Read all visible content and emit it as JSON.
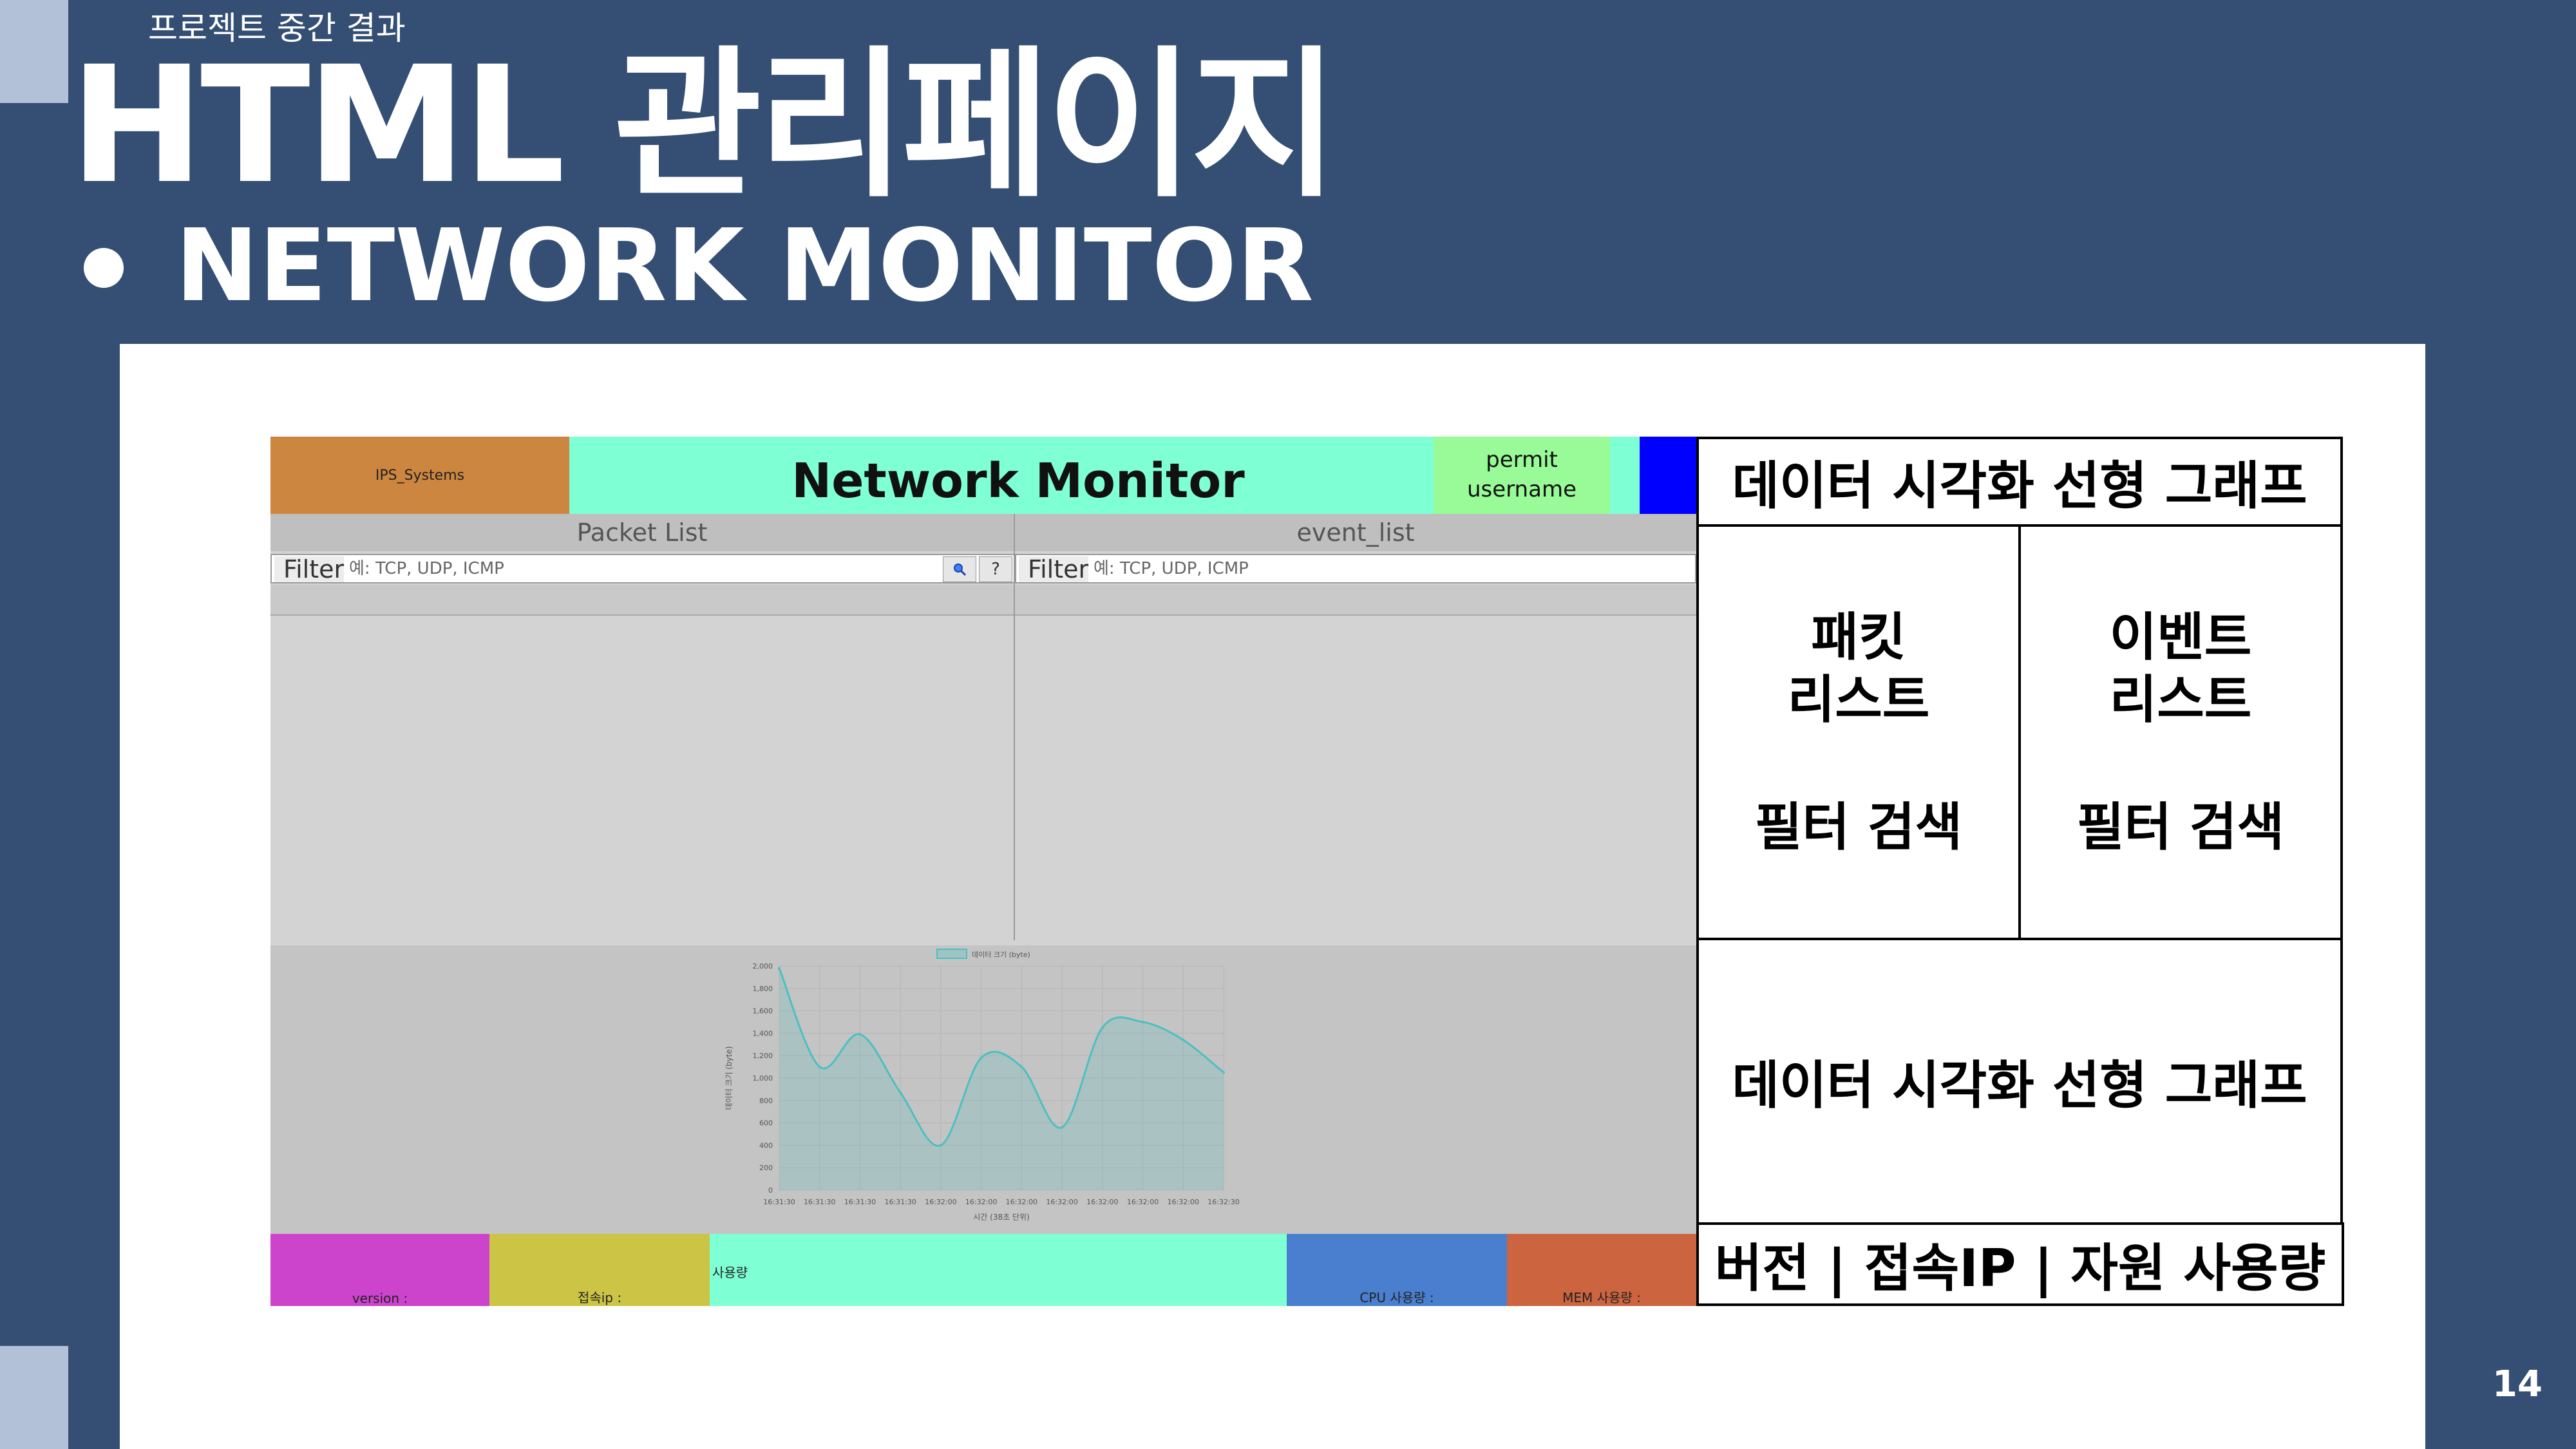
{
  "slide": {
    "kicker": "프로젝트 중간 결과",
    "title": "HTML 관리페이지",
    "section": "NETWORK MONITOR",
    "page_number": "14"
  },
  "mockup": {
    "brand": "IPS_Systems",
    "app_title": "Network Monitor",
    "permit": "permit",
    "username": "username",
    "packet_list": {
      "title": "Packet List",
      "filter_label": "Filter",
      "filter_placeholder": "예: TCP, UDP, ICMP",
      "search_icon": "search-icon",
      "help_label": "?"
    },
    "event_list": {
      "title": "event_list",
      "filter_label": "Filter",
      "filter_placeholder": "예: TCP, UDP, ICMP"
    },
    "footer": {
      "version": "version :",
      "ip": "접속ip :",
      "usage": "사용량",
      "cpu": "CPU 사용량 :",
      "mem": "MEM 사용량 :"
    },
    "colors": {
      "brand_bg": "#cc863f",
      "title_bg": "#7fffd4",
      "permit_bg": "#98fb98",
      "blue": "#0000ff",
      "version_bg": "#cc44cc",
      "ip_bg": "#ccc444",
      "usage_bg": "#7fffd4",
      "cpu_bg": "#4a7fd0",
      "mem_bg": "#cc6440",
      "line": "#4cc0c0"
    }
  },
  "chart_data": {
    "type": "area",
    "legend": "데이터 크기 (byte)",
    "ylabel": "데이터 크기 (byte)",
    "xlabel": "시간 (38초 단위)",
    "ylim": [
      0,
      2000
    ],
    "yticks": [
      "0",
      "200",
      "400",
      "600",
      "800",
      "1,000",
      "1,200",
      "1,400",
      "1,600",
      "1,800",
      "2,000"
    ],
    "x": [
      "16:31:30",
      "16:31:30",
      "16:31:30",
      "16:31:30",
      "16:32:00",
      "16:32:00",
      "16:32:00",
      "16:32:00",
      "16:32:00",
      "16:32:00",
      "16:32:00",
      "16:32:30"
    ],
    "values": [
      1980,
      1100,
      1390,
      870,
      400,
      1180,
      1100,
      560,
      1450,
      1500,
      1340,
      1050
    ]
  },
  "annotations": {
    "top_graph": "데이터 시각화 선형 그래프",
    "packet_line1": "패킷",
    "packet_line2": "리스트",
    "packet_line3": "필터 검색",
    "event_line1": "이벤트",
    "event_line2": "리스트",
    "event_line3": "필터 검색",
    "bottom_graph": "데이터 시각화 선형 그래프",
    "footer_desc": "버전 | 접속IP | 자원 사용량"
  }
}
